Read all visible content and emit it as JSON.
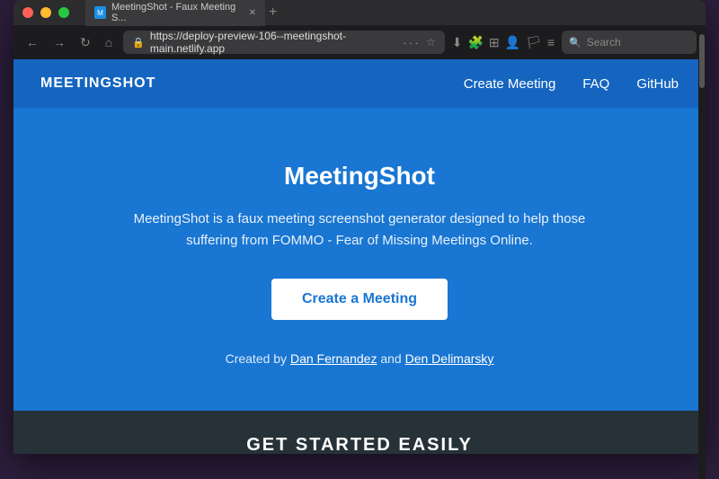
{
  "browser": {
    "tab_title": "MeetingShot - Faux Meeting S...",
    "tab_favicon": "M",
    "url": "https://deploy-preview-106--meetingshot-main.netlify.app",
    "search_placeholder": "Search",
    "back_icon": "←",
    "forward_icon": "→",
    "refresh_icon": "↻",
    "home_icon": "⌂",
    "lock_icon": "🔒",
    "bookmark_icon": "☆",
    "menu_dots": "···"
  },
  "site": {
    "brand": "MEETINGSHOT",
    "nav": {
      "create_meeting": "Create Meeting",
      "faq": "FAQ",
      "github": "GitHub"
    },
    "hero": {
      "title": "MeetingShot",
      "description": "MeetingShot is a faux meeting screenshot generator designed to help those suffering from FOMMO - Fear of Missing Meetings Online.",
      "cta_label": "Create a Meeting",
      "credit_text_before": "Created by ",
      "credit_link1": "Dan Fernandez",
      "credit_text_middle": " and ",
      "credit_link2": "Den Delimarsky"
    },
    "footer": {
      "section_title": "GET STARTED EASILY"
    }
  },
  "colors": {
    "nav_bg": "#1565c0",
    "hero_bg": "#1976d2",
    "footer_bg": "#263238",
    "cta_text": "#1976d2"
  }
}
